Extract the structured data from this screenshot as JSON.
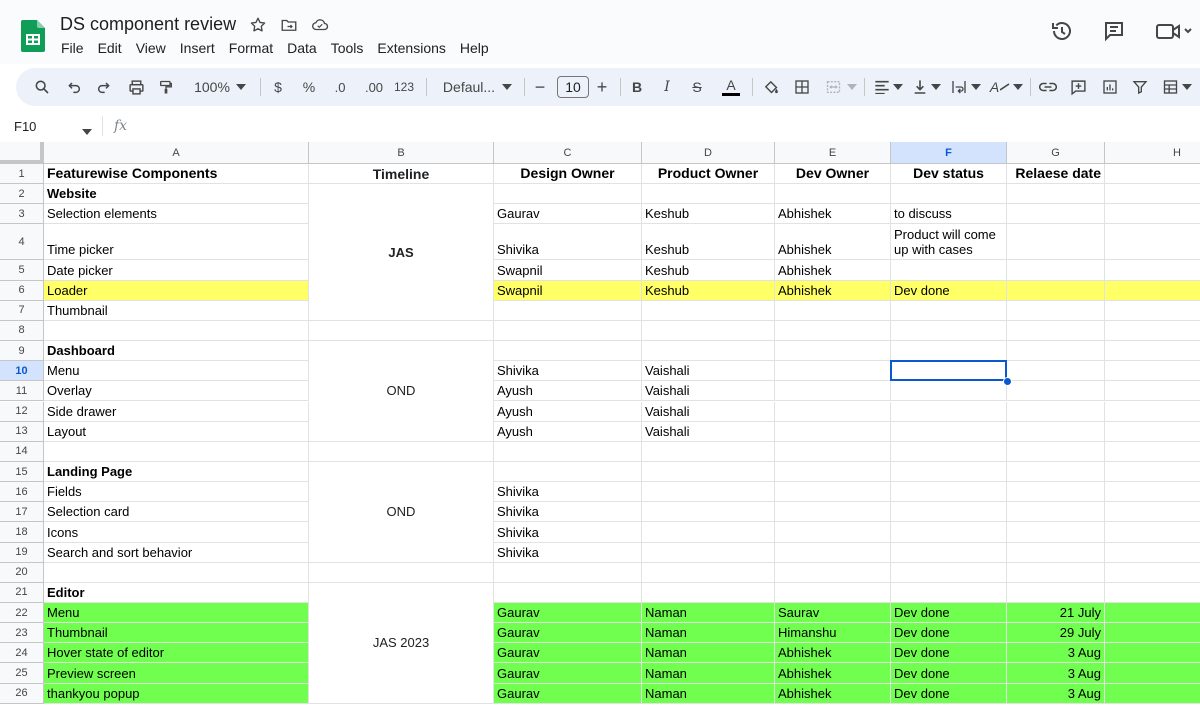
{
  "app": {
    "title": "DS component review",
    "menu": [
      "File",
      "Edit",
      "View",
      "Insert",
      "Format",
      "Data",
      "Tools",
      "Extensions",
      "Help"
    ],
    "title_icons": [
      "star-icon",
      "move-to-folder-icon",
      "cloud-status-icon"
    ],
    "right_icons": [
      "version-history-icon",
      "comments-icon",
      "meet-icon"
    ],
    "brand_color": "#0f9d58"
  },
  "toolbar": {
    "zoom": "100%",
    "currency": "$",
    "percent": "%",
    "decrease_decimal": ".0",
    "increase_decimal": ".00",
    "number_format": "123",
    "font_name": "Defaul...",
    "font_size": "10",
    "bold": "B",
    "italic": "I",
    "strikethrough": "S",
    "text_color_glyph": "A",
    "text_rotation_glyph": "A",
    "minus": "−",
    "plus": "+"
  },
  "formula_bar": {
    "name_box": "F10",
    "fx": "fx",
    "value": ""
  },
  "columns": [
    "A",
    "B",
    "C",
    "D",
    "E",
    "F",
    "G",
    "H"
  ],
  "selected_column": "F",
  "selected_row": "10",
  "rows": [
    {
      "n": "1",
      "a": "Featurewise Components",
      "c": "Design Owner",
      "d": "Product Owner",
      "e": "Dev Owner",
      "f": "Dev status",
      "g": "Relaese date",
      "header": true
    },
    {
      "n": "2",
      "a": "Website",
      "bold": true
    },
    {
      "n": "3",
      "a": "Selection elements",
      "c": "Gaurav",
      "d": "Keshub",
      "e": "Abhishek",
      "f": "to discuss"
    },
    {
      "n": "4",
      "a": "Time picker",
      "c": "Shivika",
      "d": "Keshub",
      "e": "Abhishek",
      "f": "Product will come up with cases"
    },
    {
      "n": "5",
      "a": "Date picker",
      "c": "Swapnil",
      "d": "Keshub",
      "e": "Abhishek"
    },
    {
      "n": "6",
      "a": "Loader",
      "c": "Swapnil",
      "d": "Keshub",
      "e": "Abhishek",
      "f": "Dev done",
      "fill": "yellow"
    },
    {
      "n": "7",
      "a": "Thumbnail"
    },
    {
      "n": "8"
    },
    {
      "n": "9",
      "a": "Dashboard",
      "bold": true
    },
    {
      "n": "10",
      "a": "Menu",
      "c": "Shivika",
      "d": "Vaishali"
    },
    {
      "n": "11",
      "a": "Overlay",
      "c": "Ayush",
      "d": "Vaishali"
    },
    {
      "n": "12",
      "a": "Side drawer",
      "c": "Ayush",
      "d": "Vaishali"
    },
    {
      "n": "13",
      "a": "Layout",
      "c": "Ayush",
      "d": "Vaishali"
    },
    {
      "n": "14"
    },
    {
      "n": "15",
      "a": "Landing Page",
      "bold": true
    },
    {
      "n": "16",
      "a": "Fields",
      "c": "Shivika"
    },
    {
      "n": "17",
      "a": "Selection card",
      "c": "Shivika"
    },
    {
      "n": "18",
      "a": "Icons",
      "c": "Shivika"
    },
    {
      "n": "19",
      "a": "Search and sort behavior",
      "c": "Shivika"
    },
    {
      "n": "20"
    },
    {
      "n": "21",
      "a": "Editor",
      "bold": true
    },
    {
      "n": "22",
      "a": "Menu",
      "c": "Gaurav",
      "d": "Naman",
      "e": "Saurav",
      "f": "Dev done",
      "g": "21 July",
      "fill": "green"
    },
    {
      "n": "23",
      "a": "Thumbnail",
      "c": "Gaurav",
      "d": "Naman",
      "e": "Himanshu",
      "f": "Dev done",
      "g": "29 July",
      "fill": "green"
    },
    {
      "n": "24",
      "a": "Hover state of editor",
      "c": "Gaurav",
      "d": "Naman",
      "e": "Abhishek",
      "f": "Dev done",
      "g": "3 Aug",
      "fill": "green"
    },
    {
      "n": "25",
      "a": "Preview screen",
      "c": "Gaurav",
      "d": "Naman",
      "e": "Abhishek",
      "f": "Dev done",
      "g": "3 Aug",
      "fill": "green"
    },
    {
      "n": "26",
      "a": "thankyou popup",
      "c": "Gaurav",
      "d": "Naman",
      "e": "Abhishek",
      "f": "Dev done",
      "g": "3 Aug",
      "fill": "green"
    }
  ],
  "timeline_header": "Timeline",
  "timeline_blocks": [
    {
      "label": "JAS",
      "from": 2,
      "to": 7,
      "bold": true
    },
    {
      "label": "OND",
      "from": 9,
      "to": 13,
      "bold": false
    },
    {
      "label": "OND",
      "from": 15,
      "to": 19,
      "bold": false
    },
    {
      "label": "JAS 2023",
      "from": 21,
      "to": 26,
      "bold": false
    }
  ],
  "fills": {
    "yellow": "#ffff66",
    "green": "#70ff4f",
    "selection": "#0b57d0"
  }
}
